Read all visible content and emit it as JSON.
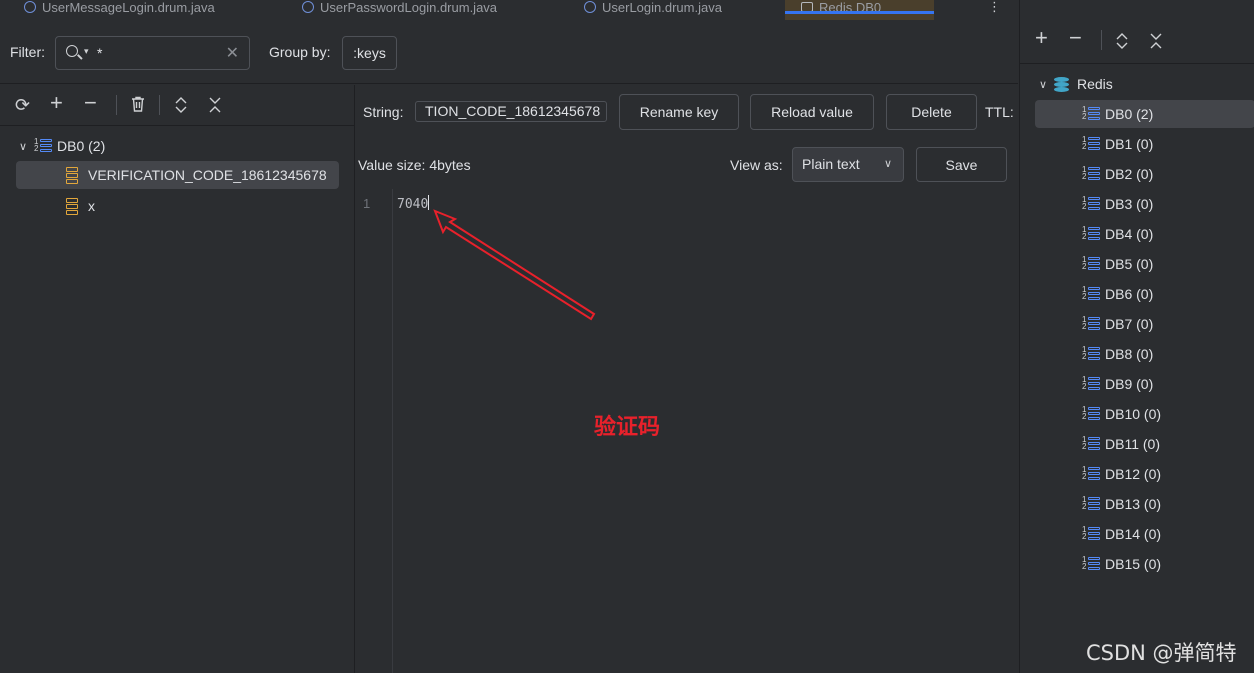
{
  "tabs": [
    {
      "label": "UserMessageLogin.drum.java"
    },
    {
      "label": "UserPasswordLogin.drum.java"
    },
    {
      "label": "UserLogin.drum.java"
    },
    {
      "label": "Redis DB0"
    }
  ],
  "filter": {
    "label": "Filter:",
    "value": "*",
    "group_label": "Group by:",
    "group_value": ":keys"
  },
  "left_tree": {
    "db_label": "DB0 (2)",
    "keys": [
      "VERIFICATION_CODE_18612345678",
      "x"
    ]
  },
  "value_panel": {
    "type_label": "String:",
    "key_name": "TION_CODE_18612345678",
    "rename_label": "Rename key",
    "reload_label": "Reload value",
    "delete_label": "Delete",
    "ttl_label": "TTL:",
    "size_label": "Value size: 4bytes",
    "view_as_label": "View as:",
    "view_as_value": "Plain text",
    "save_label": "Save",
    "line_number": "1",
    "value": "7040",
    "annotation": "验证码"
  },
  "right_tree": {
    "root": "Redis",
    "dbs": [
      "DB0 (2)",
      "DB1 (0)",
      "DB2 (0)",
      "DB3 (0)",
      "DB4 (0)",
      "DB5 (0)",
      "DB6 (0)",
      "DB7 (0)",
      "DB8 (0)",
      "DB9 (0)",
      "DB10 (0)",
      "DB11 (0)",
      "DB12 (0)",
      "DB13 (0)",
      "DB14 (0)",
      "DB15 (0)"
    ]
  },
  "watermark": "CSDN @弹简特",
  "colors": {
    "accent": "#3574f0",
    "key_icon": "#e2a73b",
    "db_icon": "#548af7",
    "annotation": "#e8212b"
  }
}
